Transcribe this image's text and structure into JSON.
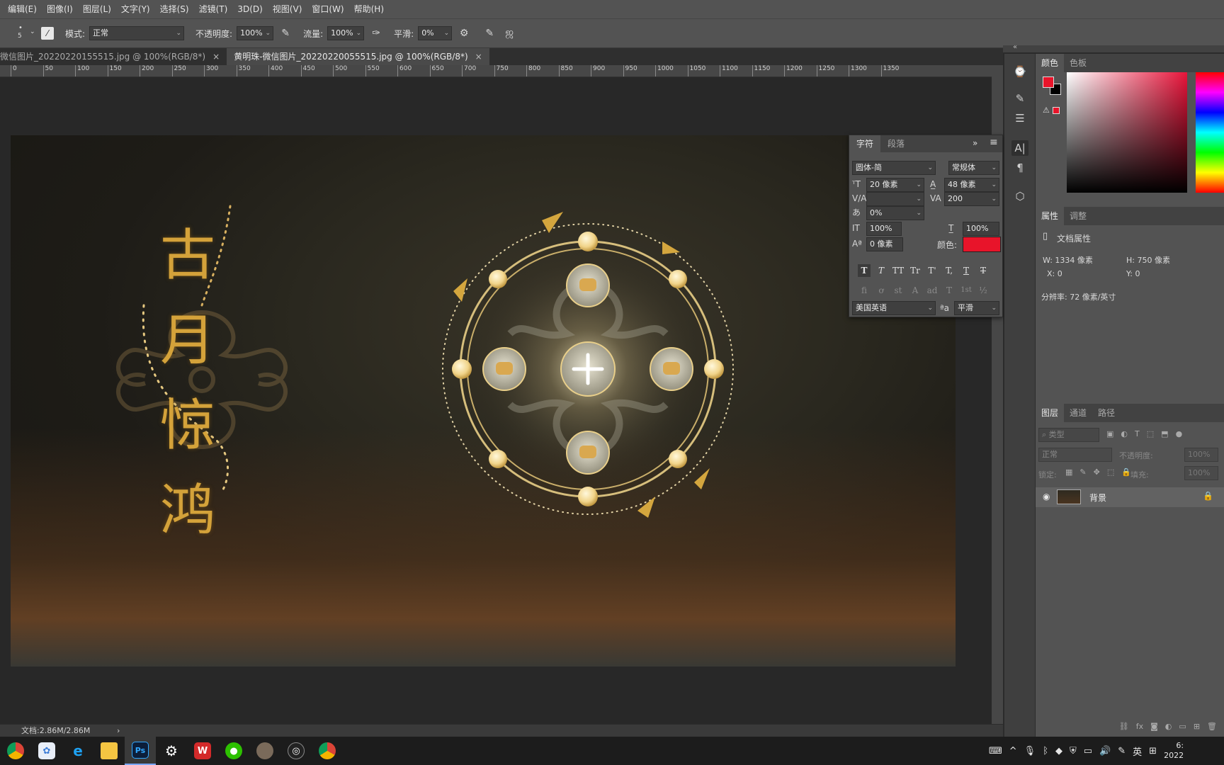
{
  "menu": [
    "编辑(E)",
    "图像(I)",
    "图层(L)",
    "文字(Y)",
    "选择(S)",
    "滤镜(T)",
    "3D(D)",
    "视图(V)",
    "窗口(W)",
    "帮助(H)"
  ],
  "options_bar": {
    "brush_size": "5",
    "mode_label": "模式:",
    "mode_value": "正常",
    "opacity_label": "不透明度:",
    "opacity_value": "100%",
    "flow_label": "流量:",
    "flow_value": "100%",
    "smoothing_label": "平滑:",
    "smoothing_value": "0%"
  },
  "tabs": [
    {
      "label": "微信图片_20220220155515.jpg @ 100%(RGB/8*)",
      "close": "×"
    },
    {
      "label": "黄明珠-微信图片_20220220055515.jpg @ 100%(RGB/8*)",
      "close": "×"
    }
  ],
  "ruler_labels": [
    "0",
    "50",
    "100",
    "150",
    "200",
    "250",
    "300",
    "350",
    "400",
    "450",
    "500",
    "550",
    "600",
    "650",
    "700",
    "750",
    "800",
    "850",
    "900",
    "950",
    "1000",
    "1050",
    "1100",
    "1150",
    "1200",
    "1250",
    "1300",
    "1350"
  ],
  "canvas": {
    "title_chars": [
      "古",
      "月",
      "惊",
      "鸿"
    ]
  },
  "character_panel": {
    "tab_character": "字符",
    "tab_paragraph": "段落",
    "font_family": "圆体-简",
    "font_style": "常规体",
    "font_size": "20 像素",
    "leading": "48 像素",
    "kerning": "",
    "tracking": "200",
    "tsume": "0%",
    "vertical_scale": "100%",
    "horizontal_scale": "100%",
    "baseline_shift": "0 像素",
    "color_label": "颜色:",
    "color_value": "#e8142a",
    "style_buttons": [
      "T",
      "T",
      "TT",
      "Tr",
      "T'",
      "T,",
      "T",
      "T"
    ],
    "opentype_buttons": [
      "fi",
      "ơ",
      "st",
      "A",
      "ad",
      "T",
      "1st",
      "½"
    ],
    "language": "美国英语",
    "aa_label": "ªa",
    "antialias": "平滑"
  },
  "color_panel": {
    "tab_color": "颜色",
    "tab_swatches": "色板",
    "foreground": "#e8142a",
    "background": "#000000"
  },
  "properties_panel": {
    "tab_properties": "属性",
    "tab_adjustments": "调整",
    "doc_props": "文档属性",
    "width": "W:  1334 像素",
    "height": "H:  750 像素",
    "x": "X:  0",
    "y": "Y:  0",
    "resolution": "分辨率: 72 像素/英寸"
  },
  "layers_panel": {
    "tab_layers": "图层",
    "tab_channels": "通道",
    "tab_paths": "路径",
    "filter_placeholder": "类型",
    "blend_mode": "正常",
    "opacity_label": "不透明度:",
    "opacity_value": "100%",
    "lock_label": "锁定:",
    "fill_label": "填充:",
    "fill_value": "100%",
    "layers": [
      {
        "name": "背景",
        "visible": true,
        "locked": true
      }
    ]
  },
  "status_bar": {
    "doc_size": "文档:2.86M/2.86M",
    "arrow": "›"
  },
  "taskbar": {
    "tray_ime": "英",
    "tray_clock_time": "6:",
    "tray_clock_date": "2022"
  }
}
